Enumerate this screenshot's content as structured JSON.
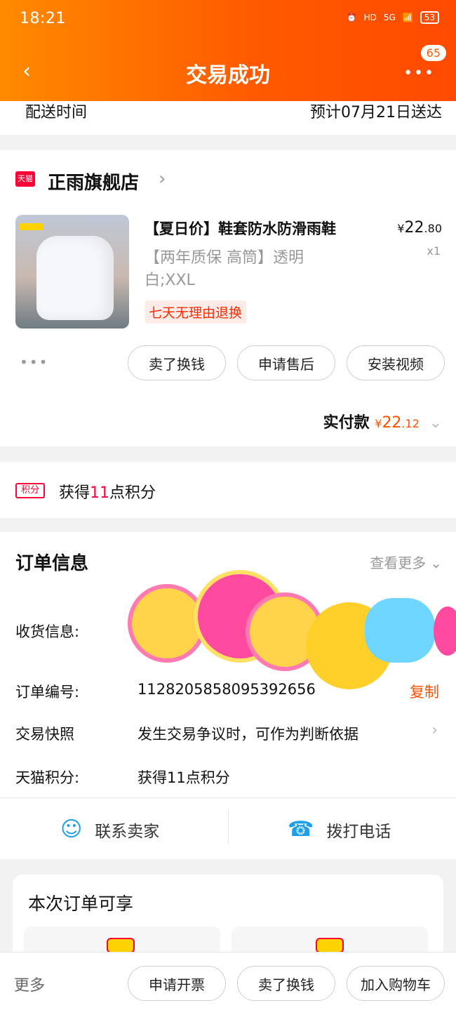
{
  "status_bar": {
    "time": "18:21",
    "battery": "53",
    "signal": "5G",
    "hd_label": "HD"
  },
  "nav": {
    "title": "交易成功",
    "back_icon": "chevron-left-icon",
    "more_icon": "ellipsis-icon",
    "badge_count": "65"
  },
  "delivery": {
    "label": "配送时间",
    "value": "预计07月21日送达"
  },
  "store": {
    "tag": "天猫",
    "name": "正雨旗舰店",
    "chevron": "›"
  },
  "item": {
    "title": "【夏日价】鞋套防水防滑雨鞋",
    "price_symbol": "¥",
    "price_int": "22",
    "price_dec": ".80",
    "qty": "x1",
    "spec": "【两年质保 高筒】透明白;XXL",
    "return_policy": "七天无理由退换",
    "more_dots": "•••"
  },
  "item_actions": [
    "卖了换钱",
    "申请售后",
    "安装视频"
  ],
  "paid": {
    "label": "实付款",
    "symbol": "¥",
    "int": "22",
    "dec": ".12",
    "chevron": "⌄"
  },
  "points": {
    "tag": "积分",
    "prefix": "获得",
    "num": "11",
    "suffix": "点积分"
  },
  "order_info": {
    "title": "订单信息",
    "view_more": "查看更多",
    "rows": [
      {
        "label": "收货信息:",
        "value": ""
      },
      {
        "label": "订单编号:",
        "value": "1128205858095392656"
      },
      {
        "label": "交易快照",
        "value": "发生交易争议时，可作为判断依据"
      },
      {
        "label": "天猫积分:",
        "value": "获得11点积分"
      }
    ],
    "copy_label": "复制"
  },
  "contact": {
    "seller_label": "联系卖家",
    "phone_label": "拨打电话"
  },
  "perks": {
    "title": "本次订单可享"
  },
  "bottom_bar": {
    "more_label": "更多",
    "actions": [
      "申请开票",
      "卖了换钱",
      "加入购物车"
    ]
  }
}
